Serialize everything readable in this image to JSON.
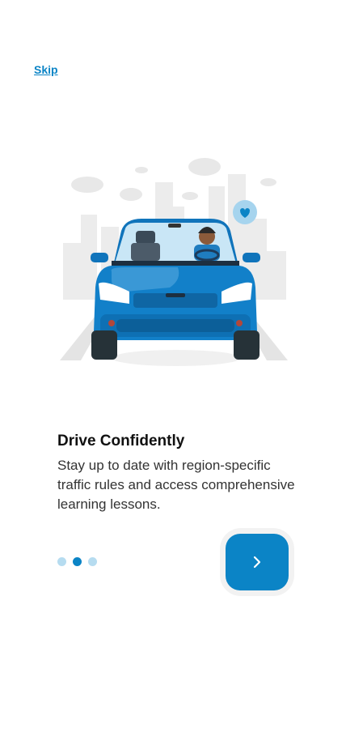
{
  "onboarding": {
    "skip_label": "Skip",
    "title": "Drive Confidently",
    "description": "Stay up to date with region-specific traffic rules and access comprehensive learning lessons.",
    "page_indicator": {
      "total": 3,
      "active_index": 1
    },
    "next_icon": "chevron-right-icon"
  },
  "colors": {
    "accent": "#0b84c6",
    "dot_inactive": "#b6dcf0",
    "title": "#111111",
    "body_text": "#333333"
  }
}
